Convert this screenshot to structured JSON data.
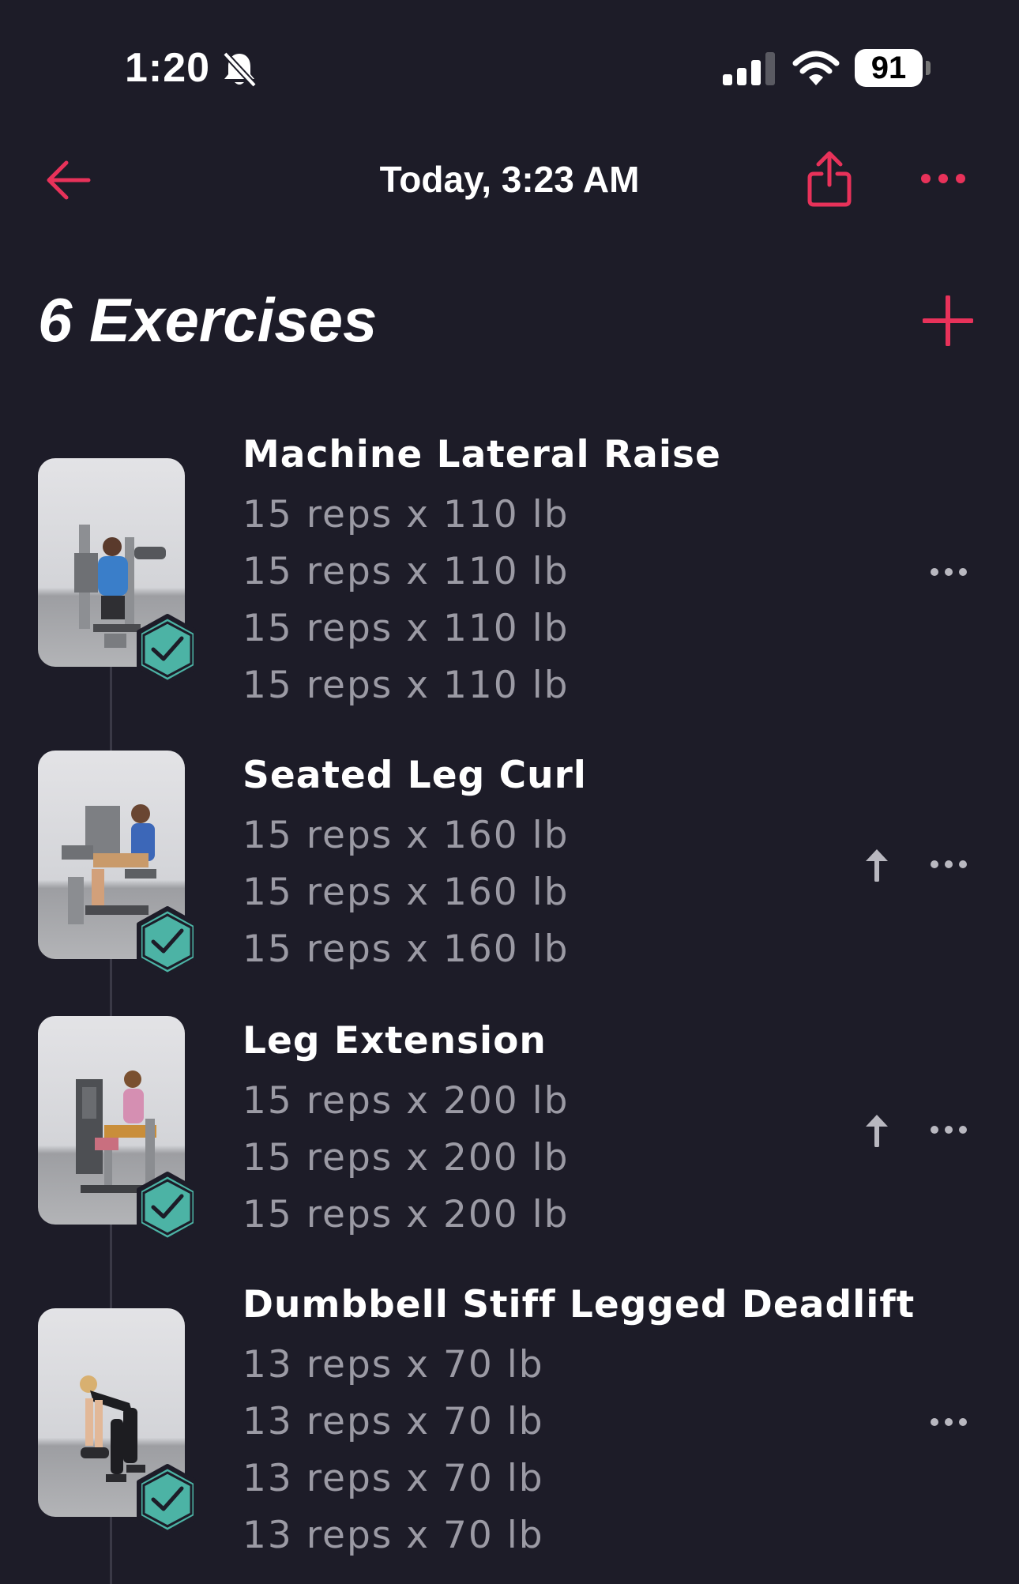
{
  "status_bar": {
    "time": "1:20",
    "battery": "91",
    "icons": [
      "bell-slash-icon",
      "cellular-signal-icon",
      "wifi-icon",
      "battery-icon"
    ]
  },
  "nav": {
    "title": "Today, 3:23 AM",
    "icons": [
      "arrow-left-icon",
      "share-icon",
      "more-horizontal-icon"
    ]
  },
  "heading": "6 Exercises",
  "colors": {
    "background": "#1d1c28",
    "accent": "#e8325a",
    "badge": "#4cb3a5",
    "secondary_text": "#9b9aa4"
  },
  "exercises": [
    {
      "name": "Machine Lateral Raise",
      "completed": true,
      "has_superset_arrow": false,
      "sets": [
        "15 reps x 110 lb",
        "15 reps x 110 lb",
        "15 reps x 110 lb",
        "15 reps x 110 lb"
      ]
    },
    {
      "name": "Seated Leg Curl",
      "completed": true,
      "has_superset_arrow": true,
      "sets": [
        "15 reps x 160 lb",
        "15 reps x 160 lb",
        "15 reps x 160 lb"
      ]
    },
    {
      "name": "Leg Extension",
      "completed": true,
      "has_superset_arrow": true,
      "sets": [
        "15 reps x 200 lb",
        "15 reps x 200 lb",
        "15 reps x 200 lb"
      ]
    },
    {
      "name": "Dumbbell Stiff Legged Deadlift",
      "completed": true,
      "has_superset_arrow": false,
      "sets": [
        "13 reps x 70 lb",
        "13 reps x 70 lb",
        "13 reps x 70 lb",
        "13 reps x 70 lb"
      ]
    }
  ]
}
